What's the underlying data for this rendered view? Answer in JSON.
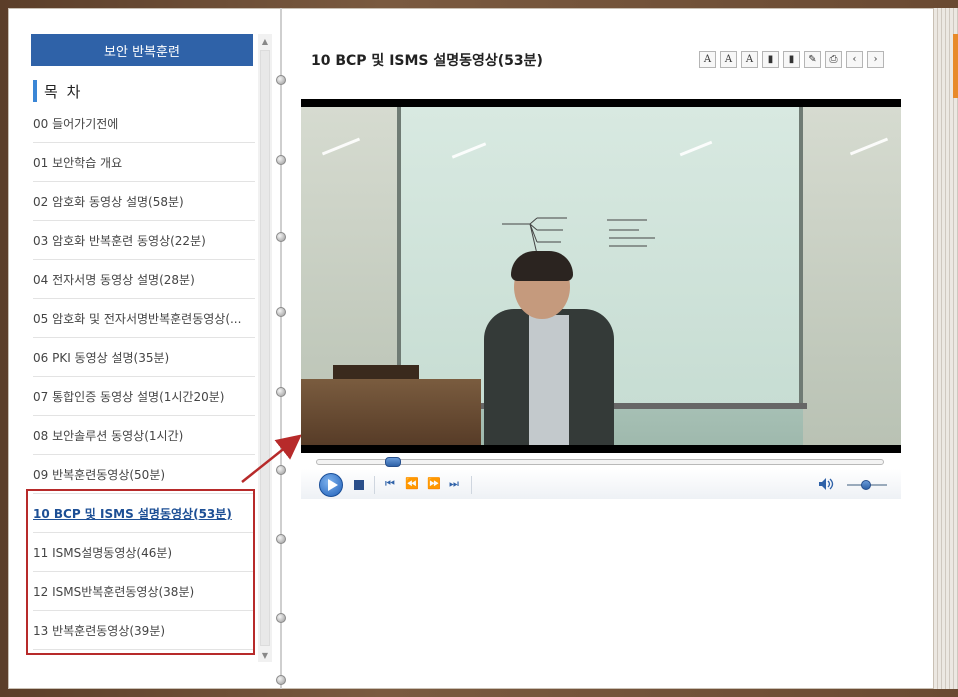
{
  "sidebar": {
    "header": "보안 반복훈련",
    "toc_title": "목 차",
    "items": [
      {
        "label": "00 들어가기전에",
        "active": false
      },
      {
        "label": "01 보안학습 개요",
        "active": false
      },
      {
        "label": "02 암호화 동영상 설명(58분)",
        "active": false
      },
      {
        "label": "03 암호화 반복훈련 동영상(22분)",
        "active": false
      },
      {
        "label": "04 전자서명 동영상 설명(28분)",
        "active": false
      },
      {
        "label": "05 암호화 및 전자서명반복훈련동영상(...",
        "active": false
      },
      {
        "label": "06 PKI 동영상 설명(35분)",
        "active": false
      },
      {
        "label": "07 통합인증 동영상 설명(1시간20분)",
        "active": false
      },
      {
        "label": "08 보안솔루션 동영상(1시간)",
        "active": false
      },
      {
        "label": "09 반복훈련동영상(50분)",
        "active": false
      },
      {
        "label": "10 BCP 및 ISMS 설명동영상(53분)",
        "active": true
      },
      {
        "label": "11 ISMS설명동영상(46분)",
        "active": false
      },
      {
        "label": "12 ISMS반복훈련동영상(38분)",
        "active": false
      },
      {
        "label": "13 반복훈련동영상(39분)",
        "active": false
      }
    ]
  },
  "content": {
    "title": "10 BCP 및 ISMS 설명동영상(53분)",
    "toolbar": [
      {
        "name": "font-reset-icon",
        "glyph": "A"
      },
      {
        "name": "font-increase-icon",
        "glyph": "A"
      },
      {
        "name": "font-decrease-icon",
        "glyph": "A"
      },
      {
        "name": "bookmark-icon",
        "glyph": "▮"
      },
      {
        "name": "bookmark-list-icon",
        "glyph": "▮"
      },
      {
        "name": "memo-icon",
        "glyph": "✎"
      },
      {
        "name": "print-icon",
        "glyph": "⎙"
      },
      {
        "name": "prev-page-icon",
        "glyph": "‹"
      },
      {
        "name": "next-page-icon",
        "glyph": "›"
      }
    ]
  },
  "player": {
    "progress": 0.13,
    "volume": 0.6,
    "icons": [
      "play-icon",
      "stop-icon",
      "skip-back-icon",
      "rewind-icon",
      "fast-forward-icon",
      "skip-forward-icon",
      "volume-icon"
    ],
    "accent": "#2f62a8"
  },
  "annotation": {
    "highlight_color": "#b72a2a"
  }
}
